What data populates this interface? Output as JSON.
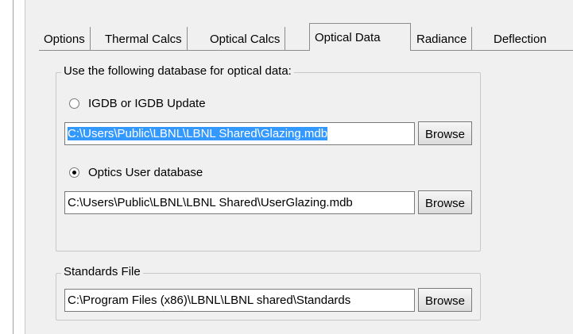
{
  "tabs": [
    {
      "label": "Options"
    },
    {
      "label": "Thermal Calcs"
    },
    {
      "label": "Optical Calcs"
    },
    {
      "label": "Optical Data",
      "active": true
    },
    {
      "label": "Radiance"
    },
    {
      "label": "Deflection"
    }
  ],
  "database_group": {
    "legend": "Use the following database for optical data:",
    "igdb": {
      "label": "IGDB or IGDB Update",
      "selected": false,
      "path": "C:\\Users\\Public\\LBNL\\LBNL Shared\\Glazing.mdb",
      "browse_label": "Browse"
    },
    "user_db": {
      "label": "Optics User database",
      "selected": true,
      "path": "C:\\Users\\Public\\LBNL\\LBNL Shared\\UserGlazing.mdb",
      "browse_label": "Browse"
    }
  },
  "standards_group": {
    "legend": "Standards File",
    "path": "C:\\Program Files (x86)\\LBNL\\LBNL shared\\Standards",
    "browse_label": "Browse"
  }
}
